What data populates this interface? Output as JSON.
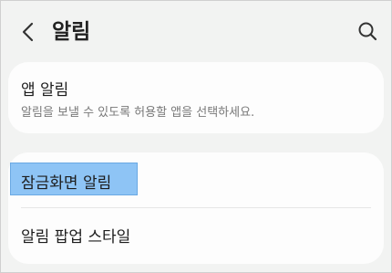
{
  "header": {
    "back_icon": "chevron-left-icon",
    "title": "알림",
    "search_icon": "search-icon"
  },
  "app_notifications": {
    "title": "앱 알림",
    "subtitle": "알림을 보낼 수 있도록 허용할 앱을 선택하세요."
  },
  "lock_screen": {
    "title": "잠금화면 알림",
    "highlight_color": "#8ec4f5"
  },
  "popup_style": {
    "title": "알림 팝업 스타일"
  }
}
